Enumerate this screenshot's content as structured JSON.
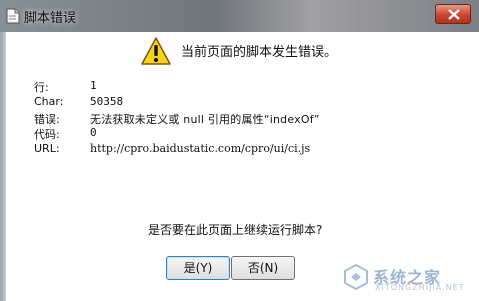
{
  "window": {
    "title": "脚本错误"
  },
  "header": {
    "message": "当前页面的脚本发生错误。"
  },
  "details": {
    "line_label": "行:",
    "line_value": "1",
    "char_label": "Char:",
    "char_value": "50358",
    "error_label": "错误:",
    "error_value": "无法获取未定义或 null 引用的属性“indexOf”",
    "code_label": "代码:",
    "code_value": "0",
    "url_label": "URL:",
    "url_value": "http://cpro.baidustatic.com/cpro/ui/ci.js"
  },
  "question": "是否要在此页面上继续运行脚本?",
  "buttons": {
    "yes_label": "是(Y)",
    "no_label": "否(N)"
  },
  "watermark": {
    "text": "系统之家",
    "sub": "XITONGZHIJIA.NET"
  },
  "colors": {
    "warning_yellow": "#f6d21b",
    "close_red": "#c9462f",
    "watermark_blue": "#9fb5cf"
  },
  "icons": {
    "app": "document-icon",
    "warning": "warning-triangle-icon",
    "close": "close-x-icon"
  }
}
